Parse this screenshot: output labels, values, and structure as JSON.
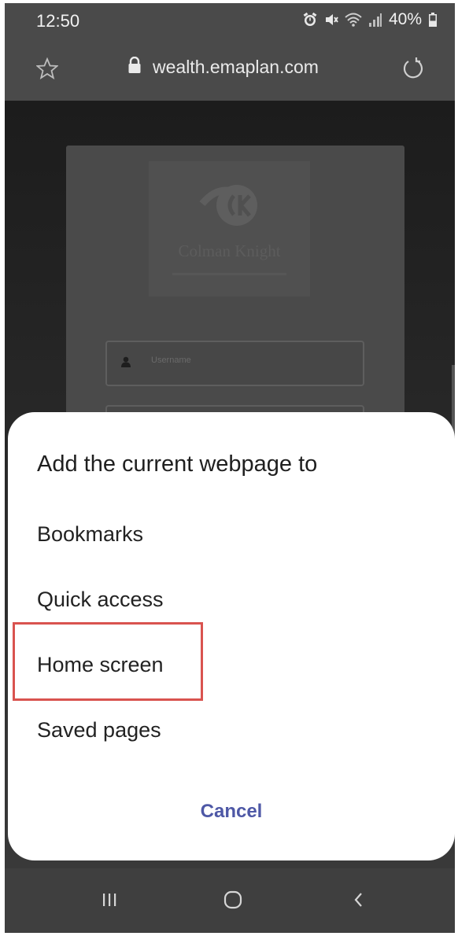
{
  "status_bar": {
    "time": "12:50",
    "battery": "40%",
    "icons": [
      "alarm-icon",
      "mute-icon",
      "wifi-icon",
      "signal-icon",
      "battery-icon"
    ]
  },
  "browser": {
    "url": "wealth.emaplan.com",
    "icons": [
      "star-icon",
      "lock-icon",
      "reload-icon"
    ]
  },
  "webpage": {
    "logo_name": "Colman Knight",
    "username_placeholder": "Username"
  },
  "sheet": {
    "title": "Add the current webpage to",
    "options": [
      {
        "label": "Bookmarks"
      },
      {
        "label": "Quick access"
      },
      {
        "label": "Home screen"
      },
      {
        "label": "Saved pages"
      }
    ],
    "highlighted_option": "Home screen",
    "cancel_label": "Cancel"
  },
  "colors": {
    "accent": "#4e58a6",
    "highlight": "#d9534f"
  },
  "nav_bar": {
    "icons": [
      "recents-icon",
      "home-icon",
      "back-icon"
    ]
  }
}
